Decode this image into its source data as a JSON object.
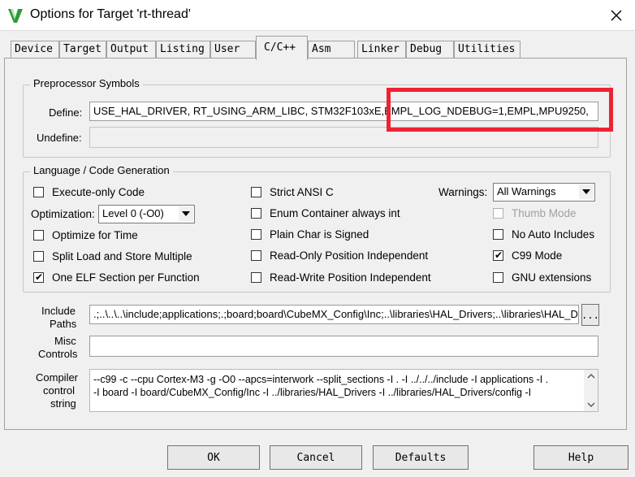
{
  "window": {
    "title": "Options for Target 'rt-thread'"
  },
  "tabs": [
    "Device",
    "Target",
    "Output",
    "Listing",
    "User",
    "C/C++",
    "Asm",
    "Linker",
    "Debug",
    "Utilities"
  ],
  "preprocessor": {
    "group_title": "Preprocessor Symbols",
    "define_label": "Define:",
    "define_value": "USE_HAL_DRIVER, RT_USING_ARM_LIBC, STM32F103xE,EMPL_LOG_NDEBUG=1,EMPL,MPU9250,",
    "undefine_label": "Undefine:",
    "undefine_value": ""
  },
  "language": {
    "group_title": "Language / Code Generation",
    "execute_only": "Execute-only Code",
    "optimization_label": "Optimization:",
    "optimization_value": "Level 0 (-O0)",
    "optimize_time": "Optimize for Time",
    "split_load": "Split Load and Store Multiple",
    "one_elf": "One ELF Section per Function",
    "strict_ansi": "Strict ANSI C",
    "enum_container": "Enum Container always int",
    "plain_char": "Plain Char is Signed",
    "ro_pi": "Read-Only Position Independent",
    "rw_pi": "Read-Write Position Independent",
    "warnings_label": "Warnings:",
    "warnings_value": "All Warnings",
    "thumb_mode": "Thumb Mode",
    "no_auto_includes": "No Auto Includes",
    "c99_mode": "C99 Mode",
    "gnu_ext": "GNU extensions"
  },
  "include": {
    "label_line1": "Include",
    "label_line2": "Paths",
    "value": ".;..\\..\\..\\include;applications;.;board;board\\CubeMX_Config\\Inc;..\\libraries\\HAL_Drivers;..\\libraries\\HAL_Drivers\\config;",
    "browse": "..."
  },
  "misc": {
    "label_line1": "Misc",
    "label_line2": "Controls",
    "value": ""
  },
  "compiler": {
    "label_line1": "Compiler",
    "label_line2": "control",
    "label_line3": "string",
    "line1": "--c99 -c --cpu Cortex-M3 -g -O0 --apcs=interwork --split_sections -I . -I ../../../include -I applications -I .",
    "line2": "-I board -I board/CubeMX_Config/Inc -I ../libraries/HAL_Drivers -I ../libraries/HAL_Drivers/config -I"
  },
  "buttons": {
    "ok": "OK",
    "cancel": "Cancel",
    "defaults": "Defaults",
    "help": "Help"
  },
  "colors": {
    "highlight": "#ee2233",
    "icon_green": "#2e9a3a"
  }
}
